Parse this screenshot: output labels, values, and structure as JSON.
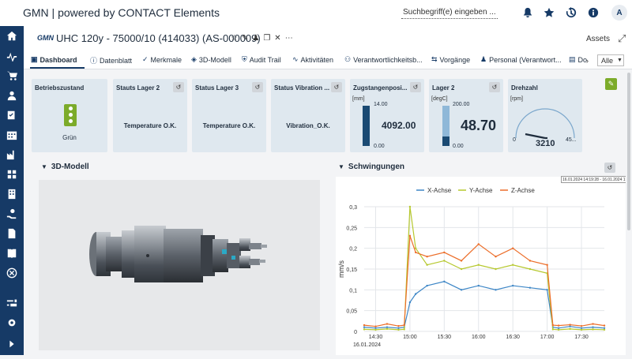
{
  "app": {
    "title": "GMN | powered by CONTACT Elements"
  },
  "search": {
    "placeholder": "Suchbegriff(e) eingeben ..."
  },
  "user": {
    "avatar_initial": "A"
  },
  "object": {
    "logo": "GMN",
    "title": "UHC 120y - 75000/10 (414033) (AS-000009)",
    "assets_label": "Assets"
  },
  "tabs": [
    {
      "label": "Dashboard",
      "icon": "dashboard-icon",
      "active": true
    },
    {
      "label": "Datenblatt",
      "icon": "info-icon"
    },
    {
      "label": "Merkmale",
      "icon": "tag-icon"
    },
    {
      "label": "3D-Modell",
      "icon": "cube-icon"
    },
    {
      "label": "Audit Trail",
      "icon": "shield-icon"
    },
    {
      "label": "Aktivitäten",
      "icon": "activity-icon"
    },
    {
      "label": "Verantwortlichkeitsb...",
      "icon": "people-icon"
    },
    {
      "label": "Vorgänge",
      "icon": "flow-icon"
    },
    {
      "label": "Personal (Verantwort...",
      "icon": "person-icon"
    },
    {
      "label": "Do",
      "icon": "document-icon"
    }
  ],
  "filter": {
    "selected": "Alle"
  },
  "cards": {
    "betriebszustand": {
      "title": "Betriebszustand",
      "value": "Grün"
    },
    "lager2_status": {
      "title": "Stauts Lager 2",
      "value": "Temperature O.K."
    },
    "lager3_status": {
      "title": "Status Lager 3",
      "value": "Temperature O.K."
    },
    "vibration_status": {
      "title": "Status Vibration ...",
      "value": "Vibration_O.K."
    },
    "zugstange": {
      "title": "Zugstangenposi...",
      "unit": "[mm]",
      "max": "14.00",
      "min": "0.00",
      "value": "4092.00",
      "fill_fraction": 1.0
    },
    "lager2": {
      "title": "Lager 2",
      "unit": "[degC]",
      "max": "200.00",
      "min": "0.00",
      "value": "48.70",
      "fill_fraction": 0.24
    },
    "drehzahl": {
      "title": "Drehzahl",
      "unit": "[rpm]",
      "min": "0",
      "max": "45...",
      "value": "3210"
    }
  },
  "sections": {
    "model": {
      "title": "3D-Modell"
    },
    "vibration": {
      "title": "Schwingungen"
    }
  },
  "tooltip": {
    "text": "16.01.2024 14:19:28 - 16.01.2024 17:54:18"
  },
  "colors": {
    "sidebar": "#163a66",
    "accent": "#163a66",
    "gauge_fill": "#1a4a73",
    "x_axis": "#3d86c6",
    "y_axis": "#b6c82e",
    "z_axis": "#ec6e2a",
    "edit_button": "#7cab2a"
  },
  "chart_data": {
    "type": "line",
    "title": "",
    "xlabel": "",
    "ylabel": "mm/s",
    "ylim": [
      0,
      0.3
    ],
    "yticks": [
      "0",
      "0,05",
      "0,1",
      "0,15",
      "0,2",
      "0,25",
      "0,3"
    ],
    "xtick_labels": [
      "14:30",
      "15:00",
      "15:30",
      "16:00",
      "16:30",
      "17:00",
      "17:30"
    ],
    "date_label": "16.01.2024",
    "grid": true,
    "legend_position": "top",
    "x": [
      "14:20",
      "14:30",
      "14:40",
      "14:50",
      "14:55",
      "15:00",
      "15:05",
      "15:15",
      "15:30",
      "15:45",
      "16:00",
      "16:15",
      "16:30",
      "16:45",
      "17:00",
      "17:05",
      "17:10",
      "17:20",
      "17:30",
      "17:40",
      "17:50"
    ],
    "series": [
      {
        "name": "X-Achse",
        "values": [
          0.01,
          0.008,
          0.01,
          0.008,
          0.01,
          0.07,
          0.09,
          0.11,
          0.12,
          0.1,
          0.11,
          0.1,
          0.11,
          0.105,
          0.1,
          0.01,
          0.008,
          0.012,
          0.008,
          0.01,
          0.008
        ]
      },
      {
        "name": "Y-Achse",
        "values": [
          0.005,
          0.004,
          0.006,
          0.004,
          0.005,
          0.3,
          0.2,
          0.16,
          0.17,
          0.15,
          0.16,
          0.15,
          0.16,
          0.15,
          0.14,
          0.005,
          0.004,
          0.006,
          0.004,
          0.005,
          0.004
        ]
      },
      {
        "name": "Z-Achse",
        "values": [
          0.015,
          0.012,
          0.018,
          0.013,
          0.015,
          0.23,
          0.19,
          0.18,
          0.19,
          0.17,
          0.21,
          0.18,
          0.2,
          0.17,
          0.16,
          0.015,
          0.014,
          0.016,
          0.013,
          0.018,
          0.014
        ]
      }
    ]
  }
}
